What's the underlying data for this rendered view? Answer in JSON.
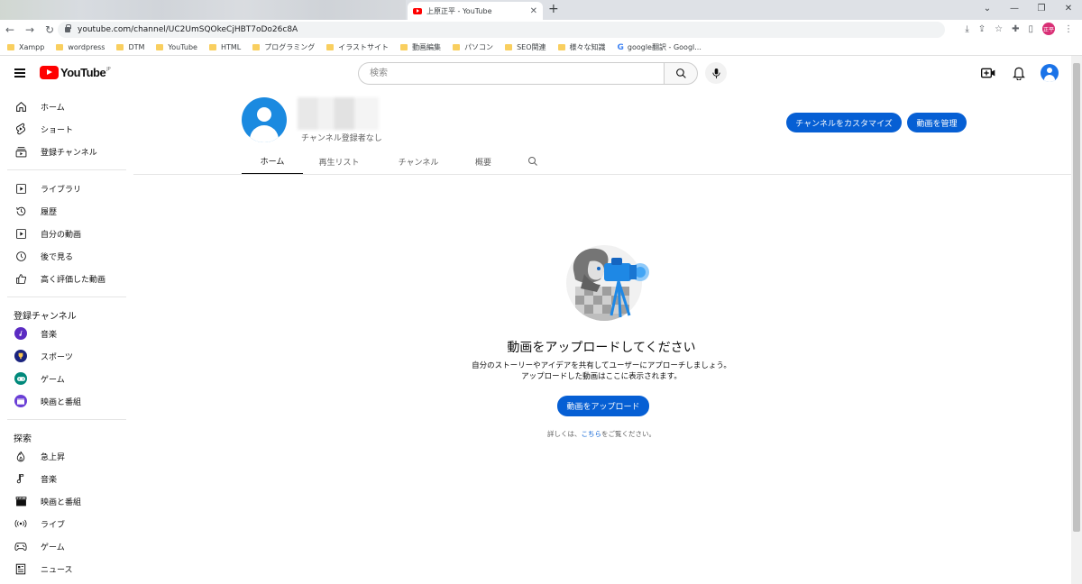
{
  "browser": {
    "active_tab_title": "上原正平 - YouTube",
    "new_tab": "+",
    "url": "youtube.com/channel/UC2UmSQOkeCjHBT7oDo26c8A",
    "profile_initials": "正平",
    "bookmarks": [
      "Xampp",
      "wordpress",
      "DTM",
      "YouTube",
      "HTML",
      "プログラミング",
      "イラストサイト",
      "動画編集",
      "パソコン",
      "SEO関連",
      "様々な知識",
      "google翻訳 - Googl..."
    ]
  },
  "youtube": {
    "logo_text": "YouTube",
    "logo_region": "JP",
    "search_placeholder": "検索"
  },
  "sidebar": {
    "main": [
      {
        "label": "ホーム",
        "icon": "home-icon"
      },
      {
        "label": "ショート",
        "icon": "shorts-icon"
      },
      {
        "label": "登録チャンネル",
        "icon": "subscriptions-icon"
      }
    ],
    "library": [
      {
        "label": "ライブラリ",
        "icon": "library-icon"
      },
      {
        "label": "履歴",
        "icon": "history-icon"
      },
      {
        "label": "自分の動画",
        "icon": "your-videos-icon"
      },
      {
        "label": "後で見る",
        "icon": "watch-later-icon"
      },
      {
        "label": "高く評価した動画",
        "icon": "liked-icon"
      }
    ],
    "subscriptions_heading": "登録チャンネル",
    "subscriptions": [
      {
        "label": "音楽",
        "color": "#5b2bc2"
      },
      {
        "label": "スポーツ",
        "color": "#1a237e"
      },
      {
        "label": "ゲーム",
        "color": "#00897b"
      },
      {
        "label": "映画と番組",
        "color": "#6a3fd6"
      }
    ],
    "explore_heading": "探索",
    "explore": [
      {
        "label": "急上昇",
        "icon": "trending-icon"
      },
      {
        "label": "音楽",
        "icon": "music-icon"
      },
      {
        "label": "映画と番組",
        "icon": "movies-icon"
      },
      {
        "label": "ライブ",
        "icon": "live-icon"
      },
      {
        "label": "ゲーム",
        "icon": "gaming-icon"
      },
      {
        "label": "ニュース",
        "icon": "news-icon"
      }
    ]
  },
  "channel": {
    "subscribers": "チャンネル登録者なし",
    "customize_button": "チャンネルをカスタマイズ",
    "manage_button": "動画を管理",
    "tabs": [
      "ホーム",
      "再生リスト",
      "チャンネル",
      "概要"
    ]
  },
  "empty_state": {
    "title": "動画をアップロードしてください",
    "desc_line1": "自分のストーリーやアイデアを共有してユーザーにアプローチしましょう。",
    "desc_line2": "アップロードした動画はここに表示されます。",
    "upload_button": "動画をアップロード",
    "help_prefix": "詳しくは、",
    "help_link": "こちら",
    "help_suffix": "をご覧ください。"
  },
  "colors": {
    "accent": "#065fd4",
    "youtube_red": "#ff0000"
  }
}
